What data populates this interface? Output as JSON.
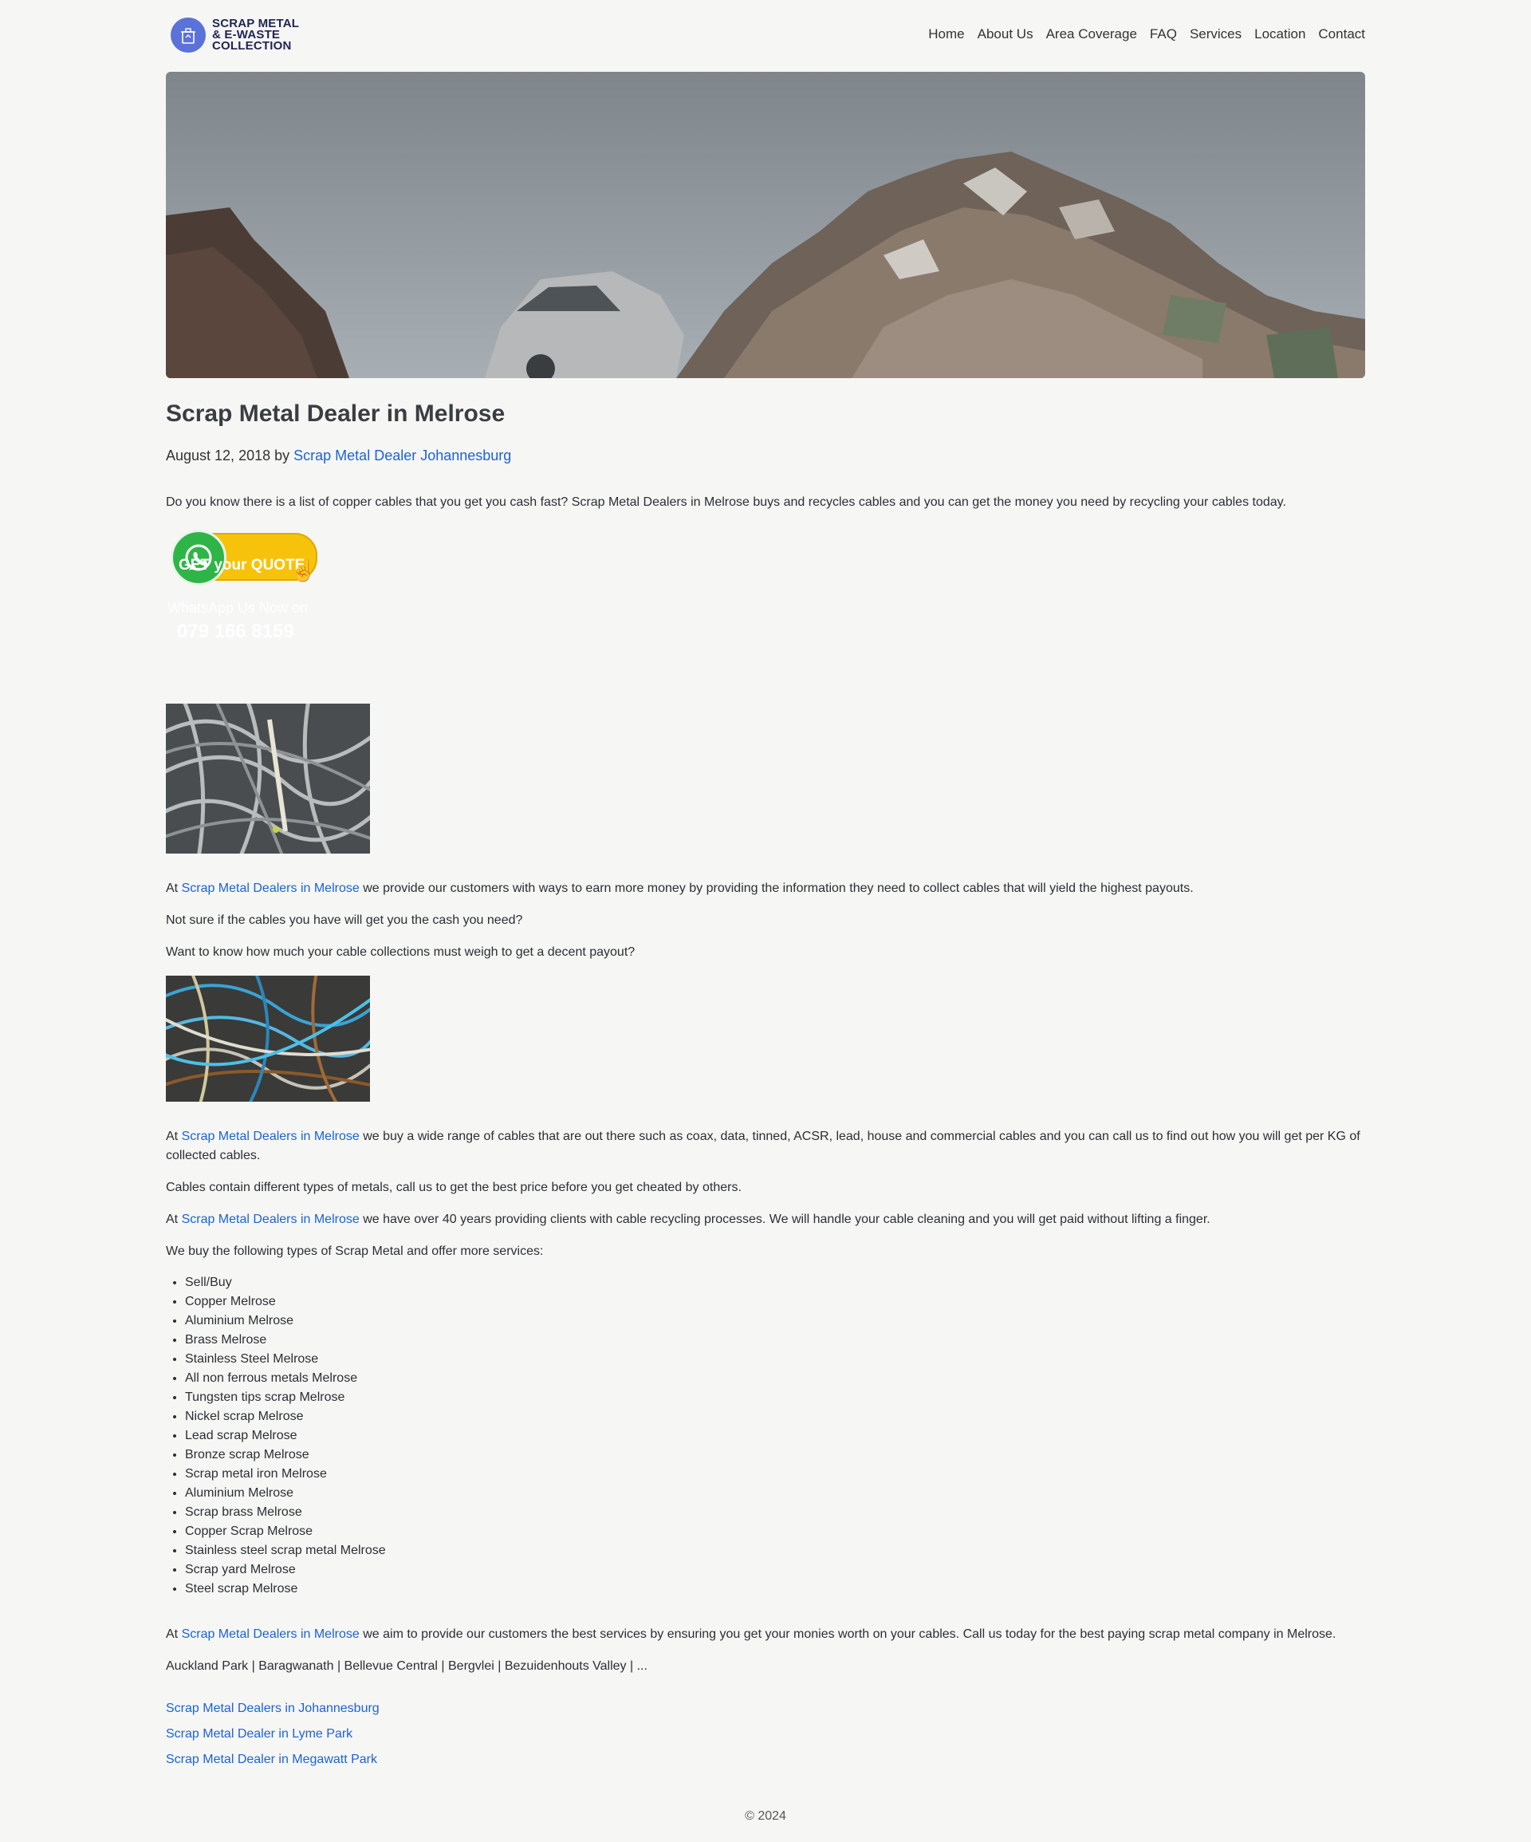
{
  "header": {
    "logo_lines": [
      "SCRAP METAL",
      "& E-WASTE",
      "COLLECTION"
    ],
    "nav": [
      "Home",
      "About Us",
      "Area Coverage",
      "FAQ",
      "Services",
      "Location",
      "Contact"
    ]
  },
  "post": {
    "title": "Scrap Metal Dealer in Melrose",
    "date": "August 12, 2018",
    "by": "by",
    "author": "Scrap Metal Dealer Johannesburg",
    "intro": "Do you know there is a list of copper cables that you get you cash fast? Scrap Metal Dealers in Melrose buys and recycles cables and you can get the money you need by recycling your cables today."
  },
  "quote_badge": {
    "button_text": "GET your QUOTE",
    "label": "WhatsApp Us Now on",
    "phone": "079 166 8159"
  },
  "link_text": "Scrap Metal Dealers in Melrose",
  "paragraphs": {
    "p1_pre": "At ",
    "p1_post": " we provide our customers with ways to earn more money by providing the information they need to collect cables that will yield the highest payouts.",
    "p2": "Not sure if the cables you have will get you the cash you need?",
    "p3": "Want to know how much your cable collections must weigh to get a decent payout?",
    "p4_pre": "At ",
    "p4_post": " we buy a wide range of cables that are out there such as coax, data, tinned, ACSR, lead, house and commercial cables and you can call us to find out how you will get per KG of collected cables.",
    "p5": "Cables contain different types of metals, call us to get the best price before you get cheated by others.",
    "p6_pre": "At ",
    "p6_post": " we have over 40 years providing clients with cable recycling processes. We will handle your cable cleaning and you will get paid without lifting a finger.",
    "p7": "We buy the following types of Scrap Metal and offer more services:",
    "p8_pre": "At ",
    "p8_post": " we aim to provide our customers the best services by ensuring you get your monies worth on your cables. Call us today for the best paying scrap metal company in Melrose.",
    "areas": "Auckland Park | Baragwanath | Bellevue Central | Bergvlei | Bezuidenhouts Valley | ..."
  },
  "services": [
    "Sell/Buy",
    "Copper Melrose",
    "Aluminium Melrose",
    "Brass Melrose",
    "Stainless Steel Melrose",
    "All non ferrous metals Melrose",
    "Tungsten tips scrap Melrose",
    "Nickel scrap Melrose",
    "Lead scrap Melrose",
    "Bronze scrap Melrose",
    "Scrap metal iron Melrose",
    "Aluminium Melrose",
    "Scrap brass Melrose",
    "Copper Scrap Melrose",
    "Stainless steel scrap metal Melrose",
    "Scrap yard Melrose",
    "Steel scrap Melrose"
  ],
  "related": [
    "Scrap Metal Dealers in Johannesburg",
    "Scrap Metal Dealer in Lyme Park",
    "Scrap Metal Dealer in Megawatt Park"
  ],
  "footer": {
    "copyright": "© 2024"
  },
  "colors": {
    "link": "#1b63d6",
    "accent_yellow": "#f7c30a",
    "whatsapp_green": "#2fb547",
    "logo_navy": "#1f2452"
  }
}
